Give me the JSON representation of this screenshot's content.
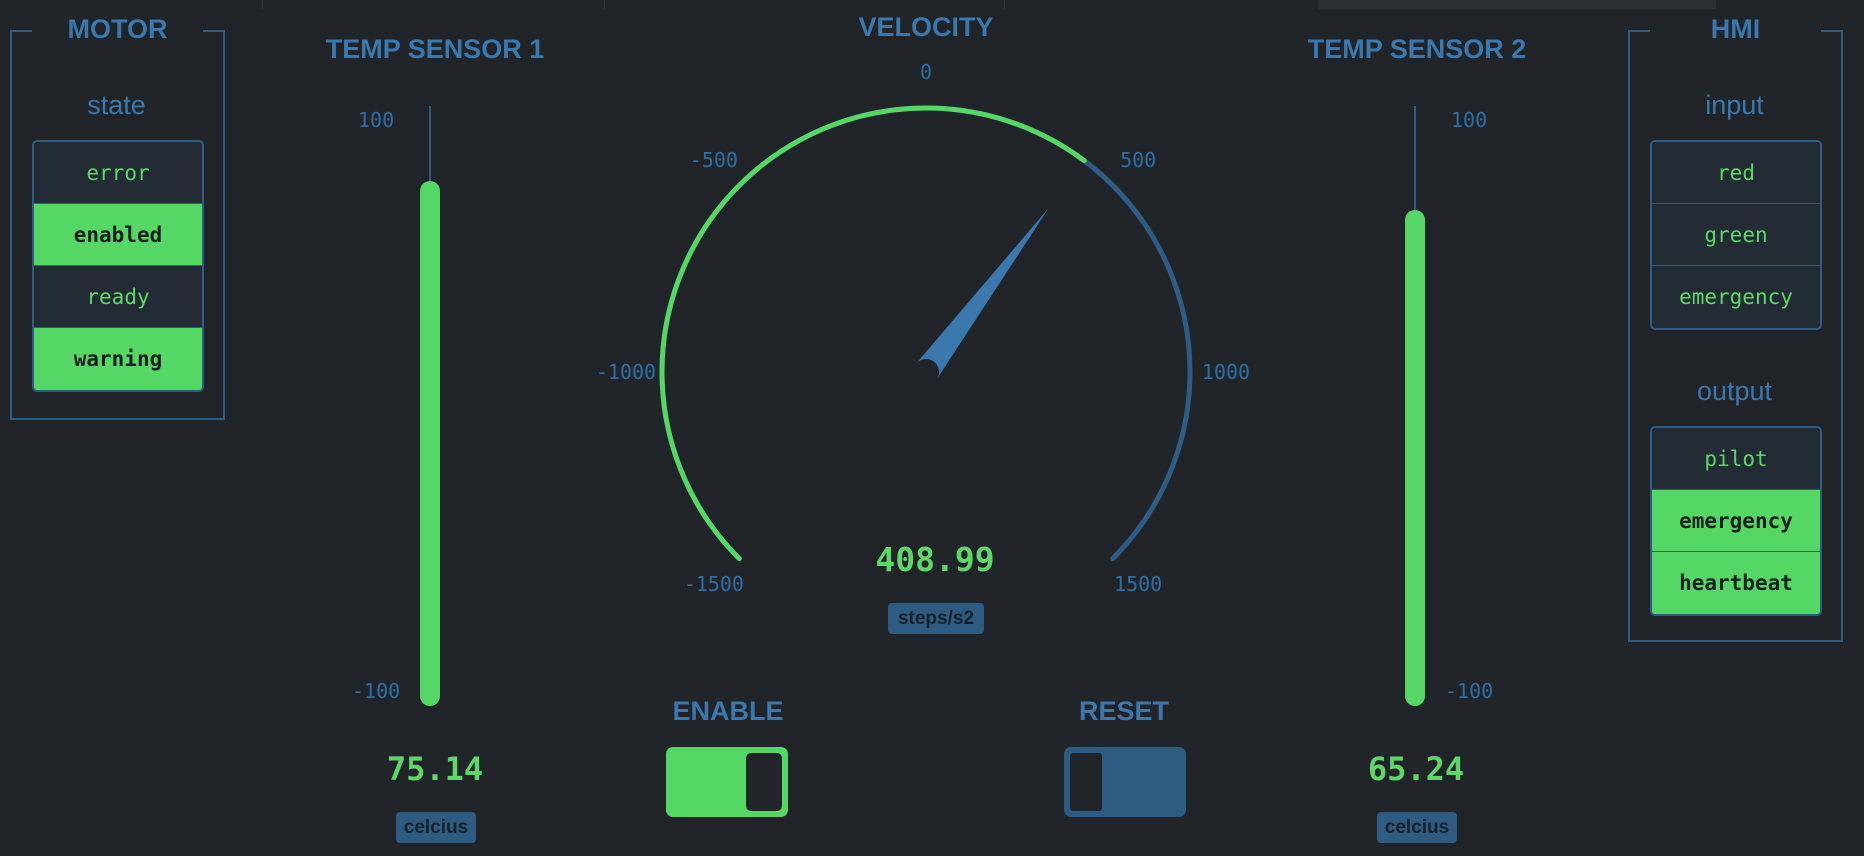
{
  "motor": {
    "title": "MOTOR",
    "state_label": "state",
    "states": [
      {
        "label": "error",
        "on": false
      },
      {
        "label": "enabled",
        "on": true
      },
      {
        "label": "ready",
        "on": false
      },
      {
        "label": "warning",
        "on": true
      }
    ]
  },
  "temp1": {
    "title": "TEMP SENSOR 1",
    "max_label": "100",
    "min_label": "-100",
    "range": [
      -100,
      100
    ],
    "value": 75.14,
    "value_text": "75.14",
    "unit": "celcius"
  },
  "velocity": {
    "title": "VELOCITY",
    "range": [
      -1500,
      1500
    ],
    "ticks": [
      "0",
      "-500",
      "500",
      "-1000",
      "1000",
      "-1500",
      "1500"
    ],
    "value": 408.99,
    "value_text": "408.99",
    "unit": "steps/s2"
  },
  "temp2": {
    "title": "TEMP SENSOR 2",
    "max_label": "100",
    "min_label": "-100",
    "range": [
      -100,
      100
    ],
    "value": 65.24,
    "value_text": "65.24",
    "unit": "celcius"
  },
  "enable": {
    "title": "ENABLE",
    "on": true
  },
  "reset": {
    "title": "RESET",
    "on": false
  },
  "hmi": {
    "title": "HMI",
    "input_label": "input",
    "inputs": [
      {
        "label": "red",
        "on": false
      },
      {
        "label": "green",
        "on": false
      },
      {
        "label": "emergency",
        "on": false
      }
    ],
    "output_label": "output",
    "outputs": [
      {
        "label": "pilot",
        "on": false
      },
      {
        "label": "emergency",
        "on": true
      },
      {
        "label": "heartbeat",
        "on": true
      }
    ]
  },
  "colors": {
    "accent": "#3A78AE",
    "active": "#55D765",
    "background": "#212429",
    "border": "#2F5C85"
  }
}
